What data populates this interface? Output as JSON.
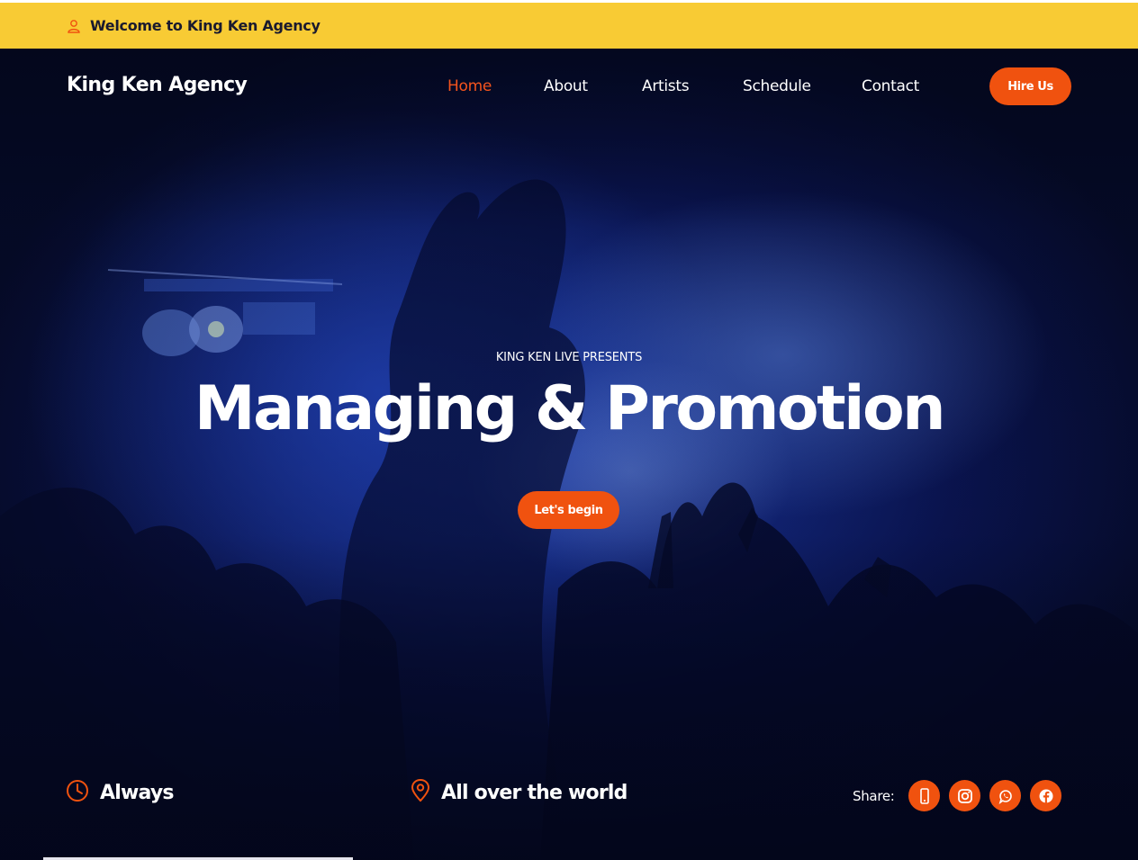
{
  "topbar": {
    "welcome_text": "Welcome to King Ken Agency",
    "icon": "user-icon",
    "background_color": "#f8cb34"
  },
  "header": {
    "brand": "King Ken Agency",
    "nav": [
      {
        "label": "Home",
        "active": true
      },
      {
        "label": "About",
        "active": false
      },
      {
        "label": "Artists",
        "active": false
      },
      {
        "label": "Schedule",
        "active": false
      },
      {
        "label": "Contact",
        "active": false
      }
    ],
    "hire_button": "Hire Us"
  },
  "hero": {
    "presents": "KING KEN LIVE PRESENTS",
    "headline": "Managing & Promotion",
    "cta_button": "Let's begin"
  },
  "info": {
    "time": {
      "icon": "clock-icon",
      "label": "Always"
    },
    "place": {
      "icon": "map-pin-icon",
      "label": "All over the world"
    }
  },
  "share": {
    "label": "Share:",
    "icons": [
      "phone-icon",
      "instagram-icon",
      "whatsapp-icon",
      "facebook-icon"
    ]
  },
  "colors": {
    "accent": "#f0520f",
    "nav_active": "#f4541d",
    "topbar": "#f8cb34",
    "hero_dark": "#070b2a"
  }
}
